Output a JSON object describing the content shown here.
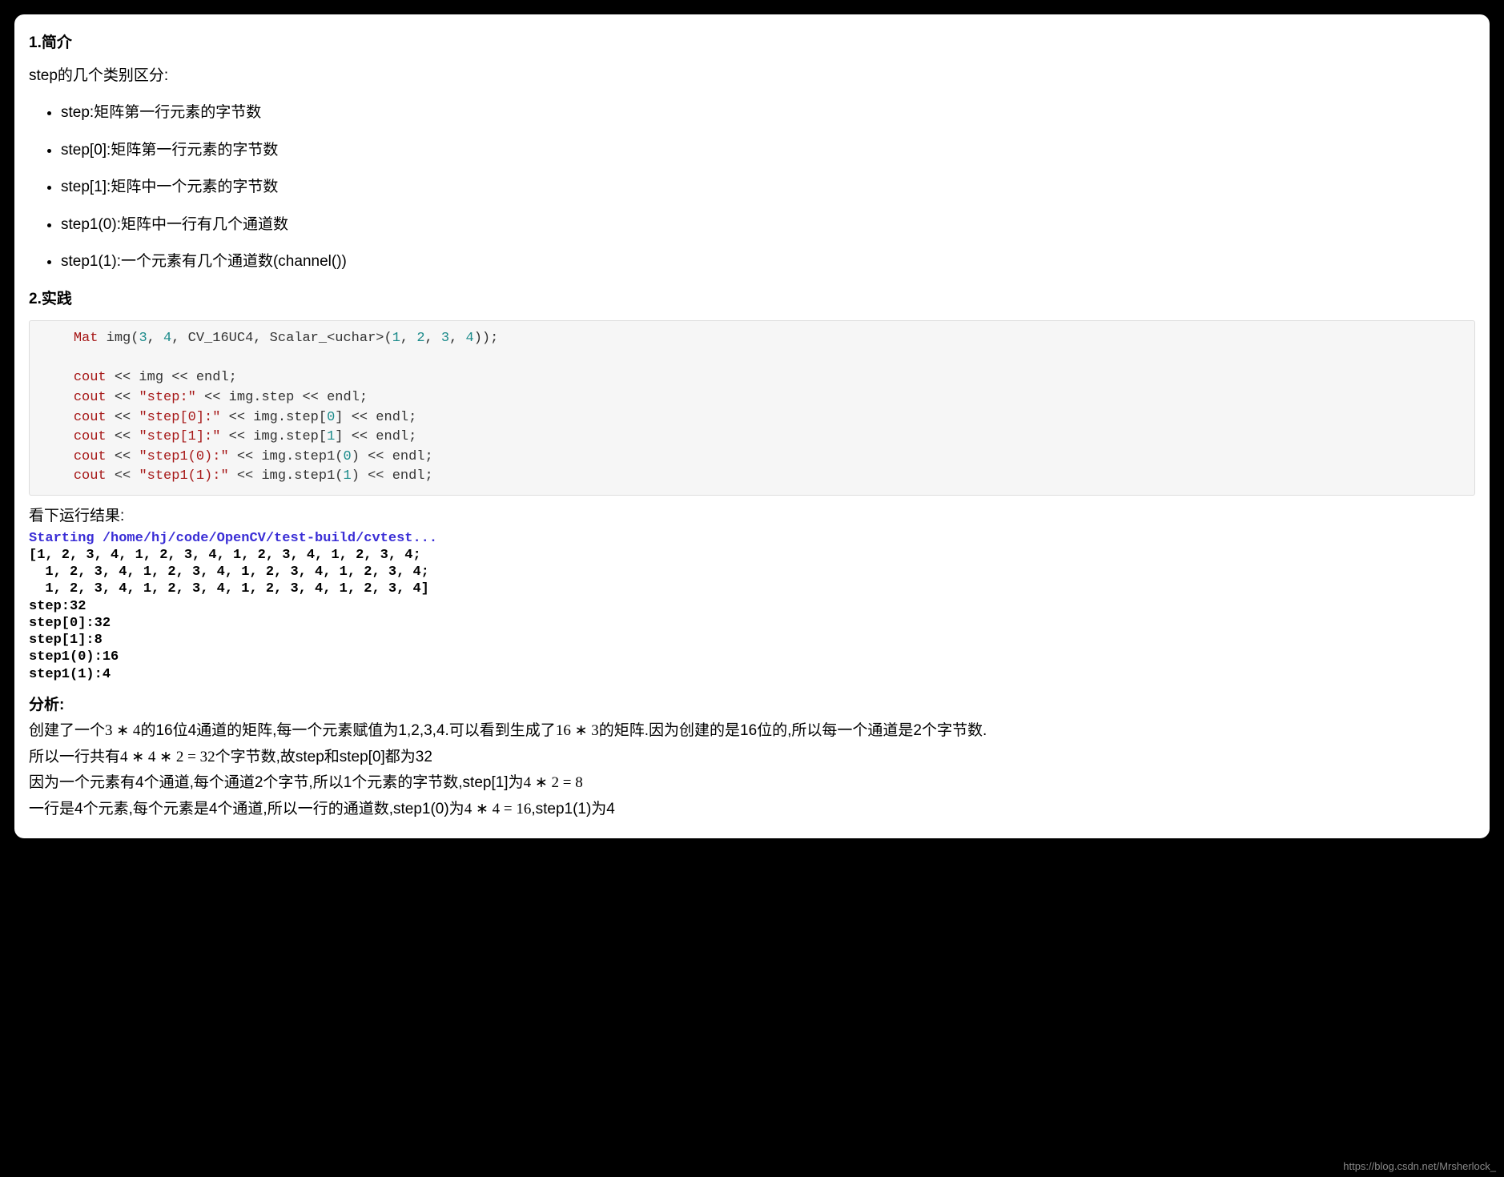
{
  "section1": {
    "title": "1.简介",
    "intro": "step的几个类别区分:",
    "items": [
      "step:矩阵第一行元素的字节数",
      "step[0]:矩阵第一行元素的字节数",
      "step[1]:矩阵中一个元素的字节数",
      "step1(0):矩阵中一行有几个通道数",
      "step1(1):一个元素有几个通道数(channel())"
    ]
  },
  "section2": {
    "title": "2.实践",
    "code": {
      "line1_pre": "    ",
      "line1_a": "Mat",
      "line1_b": " img(",
      "line1_c": "3",
      "line1_d": ", ",
      "line1_e": "4",
      "line1_f": ", CV_16UC4, Scalar_<uchar>(",
      "line1_g": "1",
      "line1_h": ", ",
      "line1_i": "2",
      "line1_j": ", ",
      "line1_k": "3",
      "line1_l": ", ",
      "line1_m": "4",
      "line1_n": "));"
    },
    "code_lines": [
      "cout << img << endl;",
      "cout << \"step:\" << img.step << endl;",
      "cout << \"step[0]:\" << img.step[0] << endl;",
      "cout << \"step[1]:\" << img.step[1] << endl;",
      "cout << \"step1(0):\" << img.step1(0) << endl;",
      "cout << \"step1(1):\" << img.step1(1) << endl;"
    ],
    "results_label": "看下运行结果:",
    "console_start": "Starting /home/hj/code/OpenCV/test-build/cvtest...",
    "console_out": "[1, 2, 3, 4, 1, 2, 3, 4, 1, 2, 3, 4, 1, 2, 3, 4;\n  1, 2, 3, 4, 1, 2, 3, 4, 1, 2, 3, 4, 1, 2, 3, 4;\n  1, 2, 3, 4, 1, 2, 3, 4, 1, 2, 3, 4, 1, 2, 3, 4]\nstep:32\nstep[0]:32\nstep[1]:8\nstep1(0):16\nstep1(1):4",
    "analysis_title": "分析:",
    "analysis_lines": {
      "l1a": "创建了一个",
      "l1b": "3 ∗ 4",
      "l1c": "的16位4通道的矩阵,每一个元素赋值为1,2,3,4.可以看到生成了",
      "l1d": "16 ∗ 3",
      "l1e": "的矩阵.因为创建的是16位的,所以每一个通道是2个字节数.",
      "l2a": "所以一行共有",
      "l2b": "4 ∗ 4 ∗ 2 = 32",
      "l2c": "个字节数,故step和step[0]都为32",
      "l3a": "因为一个元素有4个通道,每个通道2个字节,所以1个元素的字节数,step[1]为",
      "l3b": "4 ∗ 2 = 8",
      "l4a": "一行是4个元素,每个元素是4个通道,所以一行的通道数,step1(0)为",
      "l4b": "4 ∗ 4 = 16",
      "l4c": ",step1(1)为4"
    }
  },
  "watermark": "https://blog.csdn.net/Mrsherlock_"
}
